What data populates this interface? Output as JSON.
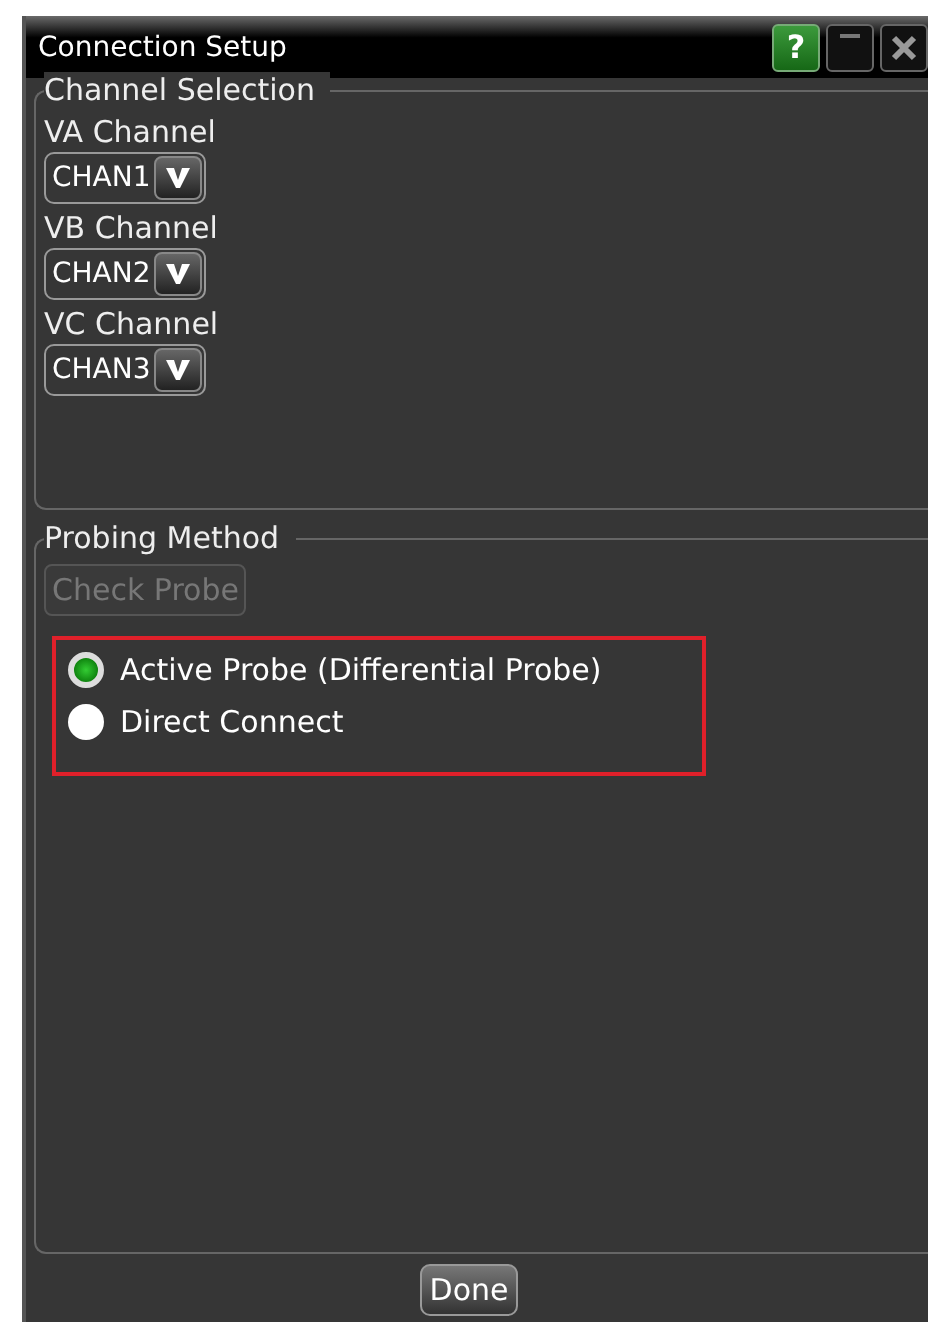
{
  "window": {
    "title": "Connection Setup",
    "help": "?"
  },
  "channel_selection": {
    "title": "Channel Selection",
    "channels": [
      {
        "label": "VA Channel",
        "value": "CHAN1"
      },
      {
        "label": "VB Channel",
        "value": "CHAN2"
      },
      {
        "label": "VC Channel",
        "value": "CHAN3"
      }
    ]
  },
  "probing_method": {
    "title": "Probing Method",
    "check_button": {
      "label": "Check Probe",
      "disabled": true
    },
    "options": [
      {
        "label": "Active Probe (Differential Probe)",
        "selected": true
      },
      {
        "label": "Direct Connect",
        "selected": false
      }
    ]
  },
  "buttons": [
    "Done"
  ]
}
